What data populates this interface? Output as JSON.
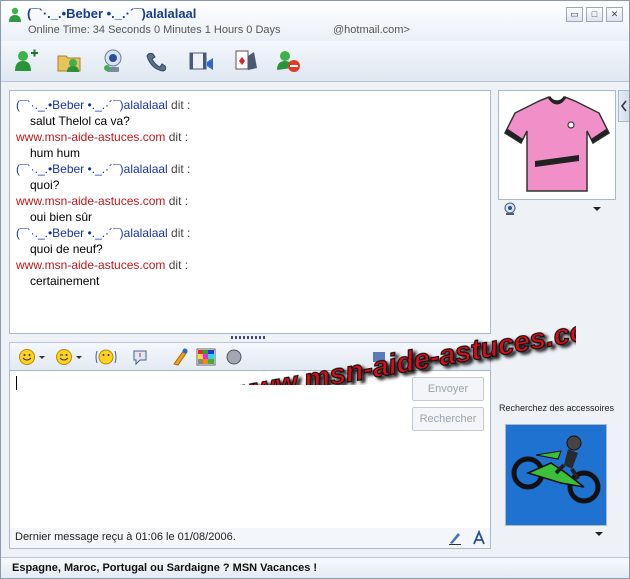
{
  "header": {
    "contact_name": "(¯`·._.•Beber •._.·´¯)alalalaal",
    "online_time": "Online Time: 34 Seconds 0 Minutes 1 Hours 0 Days",
    "email": "@hotmail.com>"
  },
  "window_buttons": {
    "minimize": "▭",
    "maximize": "□",
    "close": "✕"
  },
  "toolbar": [
    "add-contact-icon",
    "share-files-icon",
    "webcam-icon",
    "phone-icon",
    "video-icon",
    "games-icon",
    "block-icon"
  ],
  "conversation": [
    {
      "sender": "(¯`·._.•Beber •._.·´¯)alalalaal",
      "dit": "dit :",
      "color": "blue",
      "message": "salut Thelol ca va?"
    },
    {
      "sender": "www.msn-aide-astuces.com",
      "dit": "dit :",
      "color": "red",
      "message": "hum hum"
    },
    {
      "sender": "(¯`·._.•Beber •._.·´¯)alalalaal",
      "dit": "dit :",
      "color": "blue",
      "message": "quoi?"
    },
    {
      "sender": "www.msn-aide-astuces.com",
      "dit": "dit :",
      "color": "red",
      "message": "oui bien sûr"
    },
    {
      "sender": "(¯`·._.•Beber •._.·´¯)alalalaal",
      "dit": "dit :",
      "color": "blue",
      "message": "quoi de neuf?"
    },
    {
      "sender": "www.msn-aide-astuces.com",
      "dit": "dit :",
      "color": "red",
      "message": "certainement"
    }
  ],
  "input": {
    "send_label": "Envoyer",
    "search_label": "Rechercher"
  },
  "status": {
    "last_message": "Dernier message reçu à 01:06 le 01/08/2006."
  },
  "accessories": {
    "label": "Recherchez des accessoires"
  },
  "ad": {
    "text": "Espagne, Maroc, Portugal ou Sardaigne ? MSN Vacances !"
  },
  "watermark": {
    "text": "www.msn-aide-astuces.com"
  },
  "colors": {
    "nick_blue": "#1a2fb8",
    "nick_red": "#c4151c",
    "shirt_pink": "#f08fc8",
    "watermark_red": "#d8101a"
  }
}
